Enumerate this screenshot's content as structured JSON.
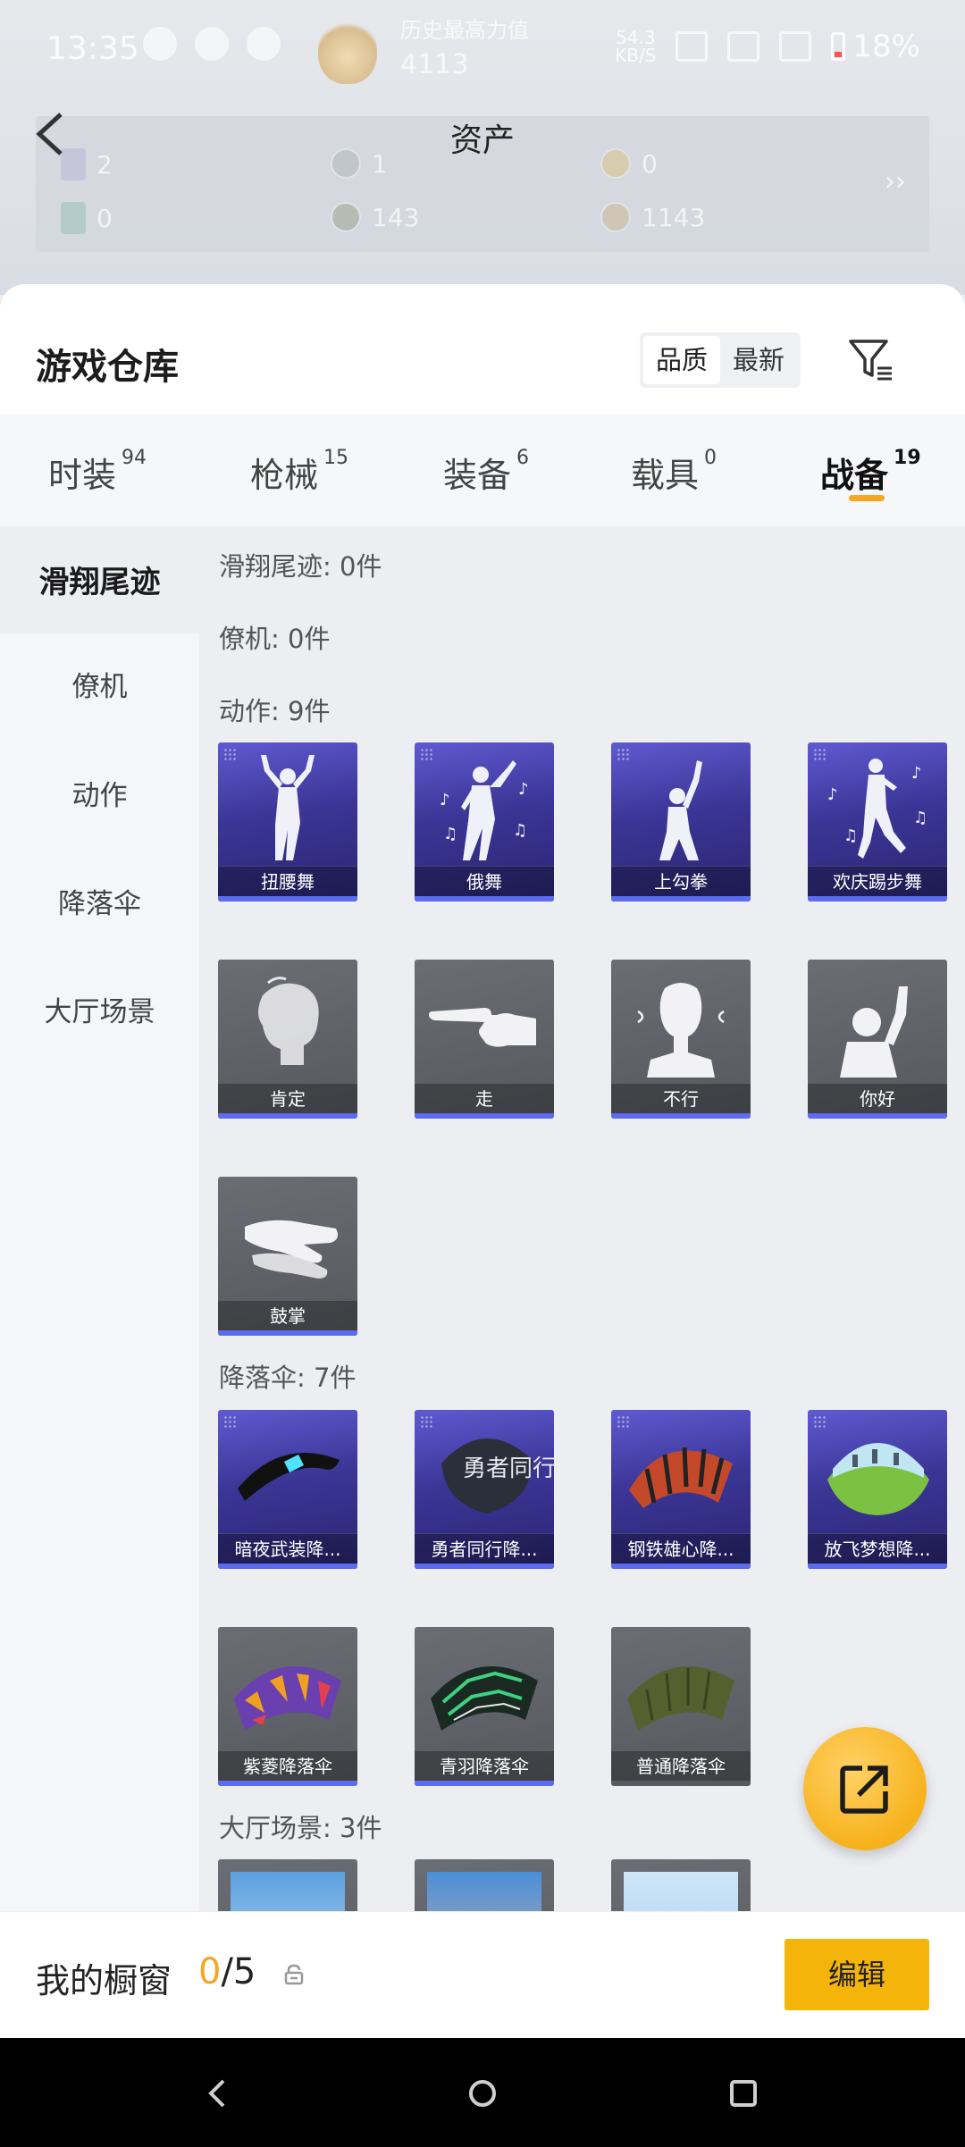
{
  "status_bar": {
    "time": "13:35",
    "record_title": "历史最高力值",
    "record_value": "4113",
    "net_speed": "54.3",
    "net_unit": "KB/S",
    "battery": "18%"
  },
  "header": {
    "title": "资产",
    "assets": [
      {
        "value": "2"
      },
      {
        "value": "1"
      },
      {
        "value": "0"
      },
      {
        "value": "0"
      },
      {
        "value": "143"
      },
      {
        "value": "1143"
      }
    ]
  },
  "warehouse": {
    "title": "游戏仓库",
    "sort_options": [
      "品质",
      "最新"
    ],
    "tabs": [
      {
        "label": "时装",
        "count": "94"
      },
      {
        "label": "枪械",
        "count": "15"
      },
      {
        "label": "装备",
        "count": "6"
      },
      {
        "label": "载具",
        "count": "0"
      },
      {
        "label": "战备",
        "count": "19"
      }
    ],
    "sidebar": [
      "滑翔尾迹",
      "僚机",
      "动作",
      "降落伞",
      "大厅场景"
    ],
    "sections": {
      "glide": "滑翔尾迹: 0件",
      "wingman": "僚机: 0件",
      "emote": "动作: 9件",
      "parachute": "降落伞: 7件",
      "lobby": "大厅场景: 3件"
    },
    "emotes": [
      "扭腰舞",
      "俄舞",
      "上勾拳",
      "欢庆踢步舞",
      "肯定",
      "走",
      "不行",
      "你好",
      "鼓掌"
    ],
    "parachutes": [
      "暗夜武装降...",
      "勇者同行降...",
      "钢铁雄心降...",
      "放飞梦想降...",
      "紫菱降落伞",
      "青羽降落伞",
      "普通降落伞"
    ],
    "parachute_art_text": "勇者同行"
  },
  "showcase": {
    "label": "我的橱窗",
    "current": "0",
    "total": "/5",
    "edit_label": "编辑"
  },
  "colors": {
    "accent": "#f5b40a",
    "rare_purple": "#3b3596",
    "common_gray": "#56585e"
  }
}
